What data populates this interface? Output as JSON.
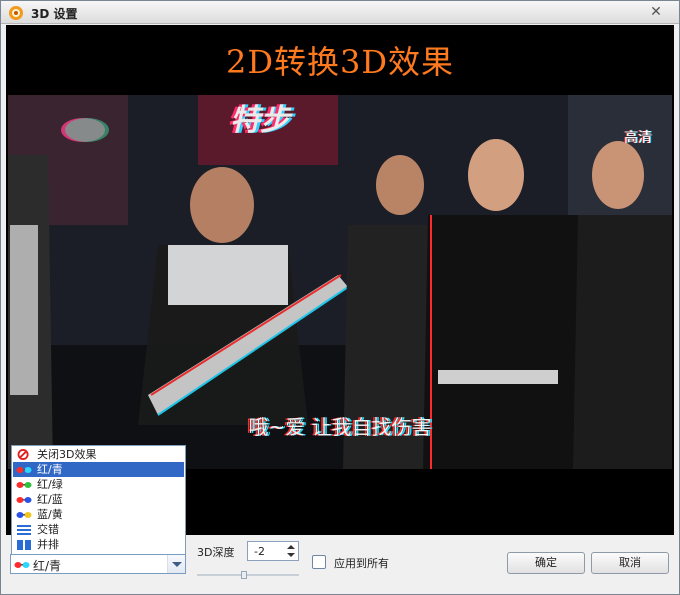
{
  "window": {
    "title": "3D 设置",
    "close_glyph": "✕"
  },
  "stage": {
    "headline": "2D转换3D效果"
  },
  "video": {
    "subtitle": "哦~爱 让我自找伤害",
    "logo_text": "特步",
    "channel_tag": "高清"
  },
  "mode_dropdown": {
    "selected": "红/青",
    "options": [
      {
        "label": "关闭3D效果",
        "icon": "no-entry-icon"
      },
      {
        "label": "红/青",
        "icon": "red-cyan-glasses-icon"
      },
      {
        "label": "红/绿",
        "icon": "red-green-glasses-icon"
      },
      {
        "label": "红/蓝",
        "icon": "red-blue-glasses-icon"
      },
      {
        "label": "蓝/黄",
        "icon": "blue-yellow-glasses-icon"
      },
      {
        "label": "交错",
        "icon": "interlaced-icon"
      },
      {
        "label": "并排",
        "icon": "side-by-side-icon"
      }
    ],
    "highlighted_index": 1
  },
  "depth": {
    "label": "3D深度",
    "value": "-2",
    "slider_fraction": 0.47
  },
  "apply_all": {
    "label": "应用到所有",
    "checked": false
  },
  "buttons": {
    "ok": "确定",
    "cancel": "取消"
  },
  "colors": {
    "headline": "#ff7a1e",
    "selection": "#3168c6"
  }
}
